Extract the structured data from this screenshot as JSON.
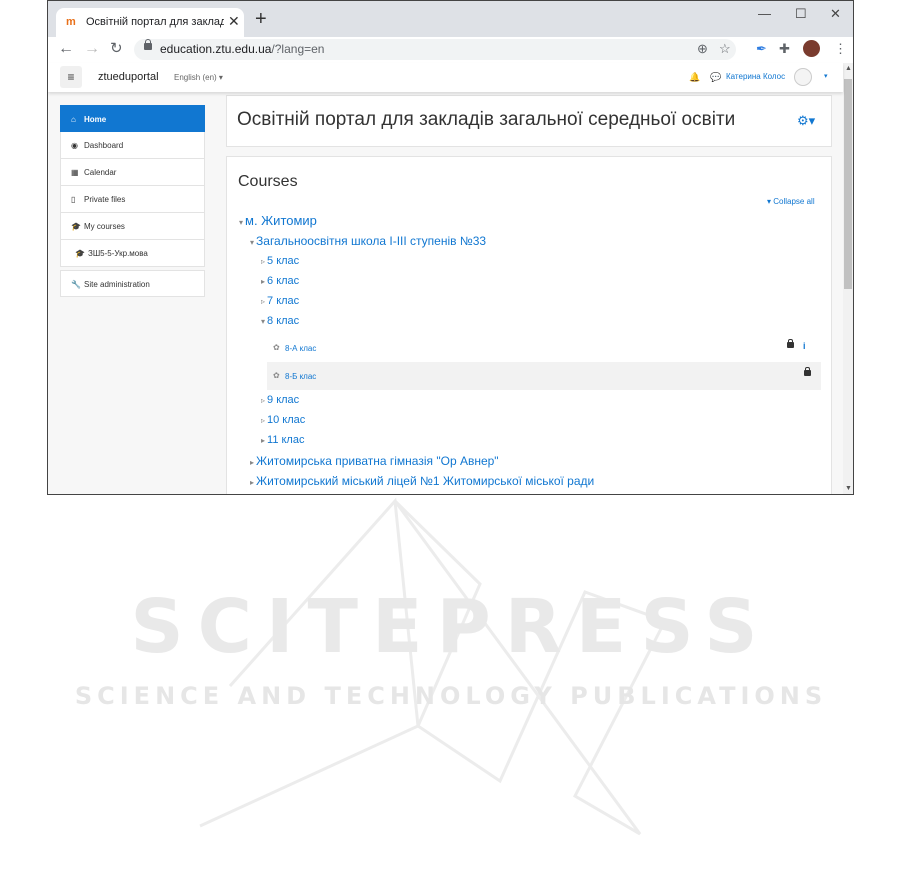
{
  "browser": {
    "tab_title": "Освітній портал для закладів за",
    "favicon": "m",
    "tab_close": "✕",
    "new_tab": "+",
    "url_host": "education.ztu.edu.ua",
    "url_path": "/?lang=en",
    "win_min": "—",
    "win_max": "☐",
    "win_close": "✕"
  },
  "navbar": {
    "menu_icon": "≡",
    "site_name": "ztueduportal",
    "language": "English (en) ▾",
    "user_name": "Катерина Колос",
    "user_caret": "▾"
  },
  "sidebar": {
    "items": [
      {
        "icon": "⌂",
        "label": "Home"
      },
      {
        "icon": "◉",
        "label": "Dashboard"
      },
      {
        "icon": "▦",
        "label": "Calendar"
      },
      {
        "icon": "▯",
        "label": "Private files"
      },
      {
        "icon": "🎓",
        "label": "My courses"
      },
      {
        "icon": "🎓",
        "label": "ЗШ5-5-Укр.мова"
      },
      {
        "icon": "🔧",
        "label": "Site administration"
      }
    ]
  },
  "main": {
    "portal_title": "Освітній портал для закладів загальної середньої освіти",
    "settings_icon": "⚙▾",
    "courses_heading": "Courses",
    "collapse_all": "Collapse all",
    "tree": {
      "city": "м. Житомир",
      "school": "Загальноосвітня школа І-ІІІ ступенів №33",
      "grades": [
        "5 клас",
        "6 клас",
        "7 клас",
        "8 клас",
        "9 клас",
        "10 клас",
        "11 клас"
      ],
      "courses": [
        "8-А клас",
        "8-Б клас"
      ],
      "course_info": "i",
      "other_schools": [
        "Житомирська приватна гімназія \"Ор Авнер\"",
        "Житомирський міський ліцей №1 Житомирської міської ради"
      ]
    }
  },
  "watermark": {
    "line1": "SCITEPRESS",
    "line2": "SCIENCE AND TECHNOLOGY PUBLICATIONS"
  },
  "colors": {
    "accent": "#1177d1",
    "page_bg": "#f7f7f7"
  }
}
